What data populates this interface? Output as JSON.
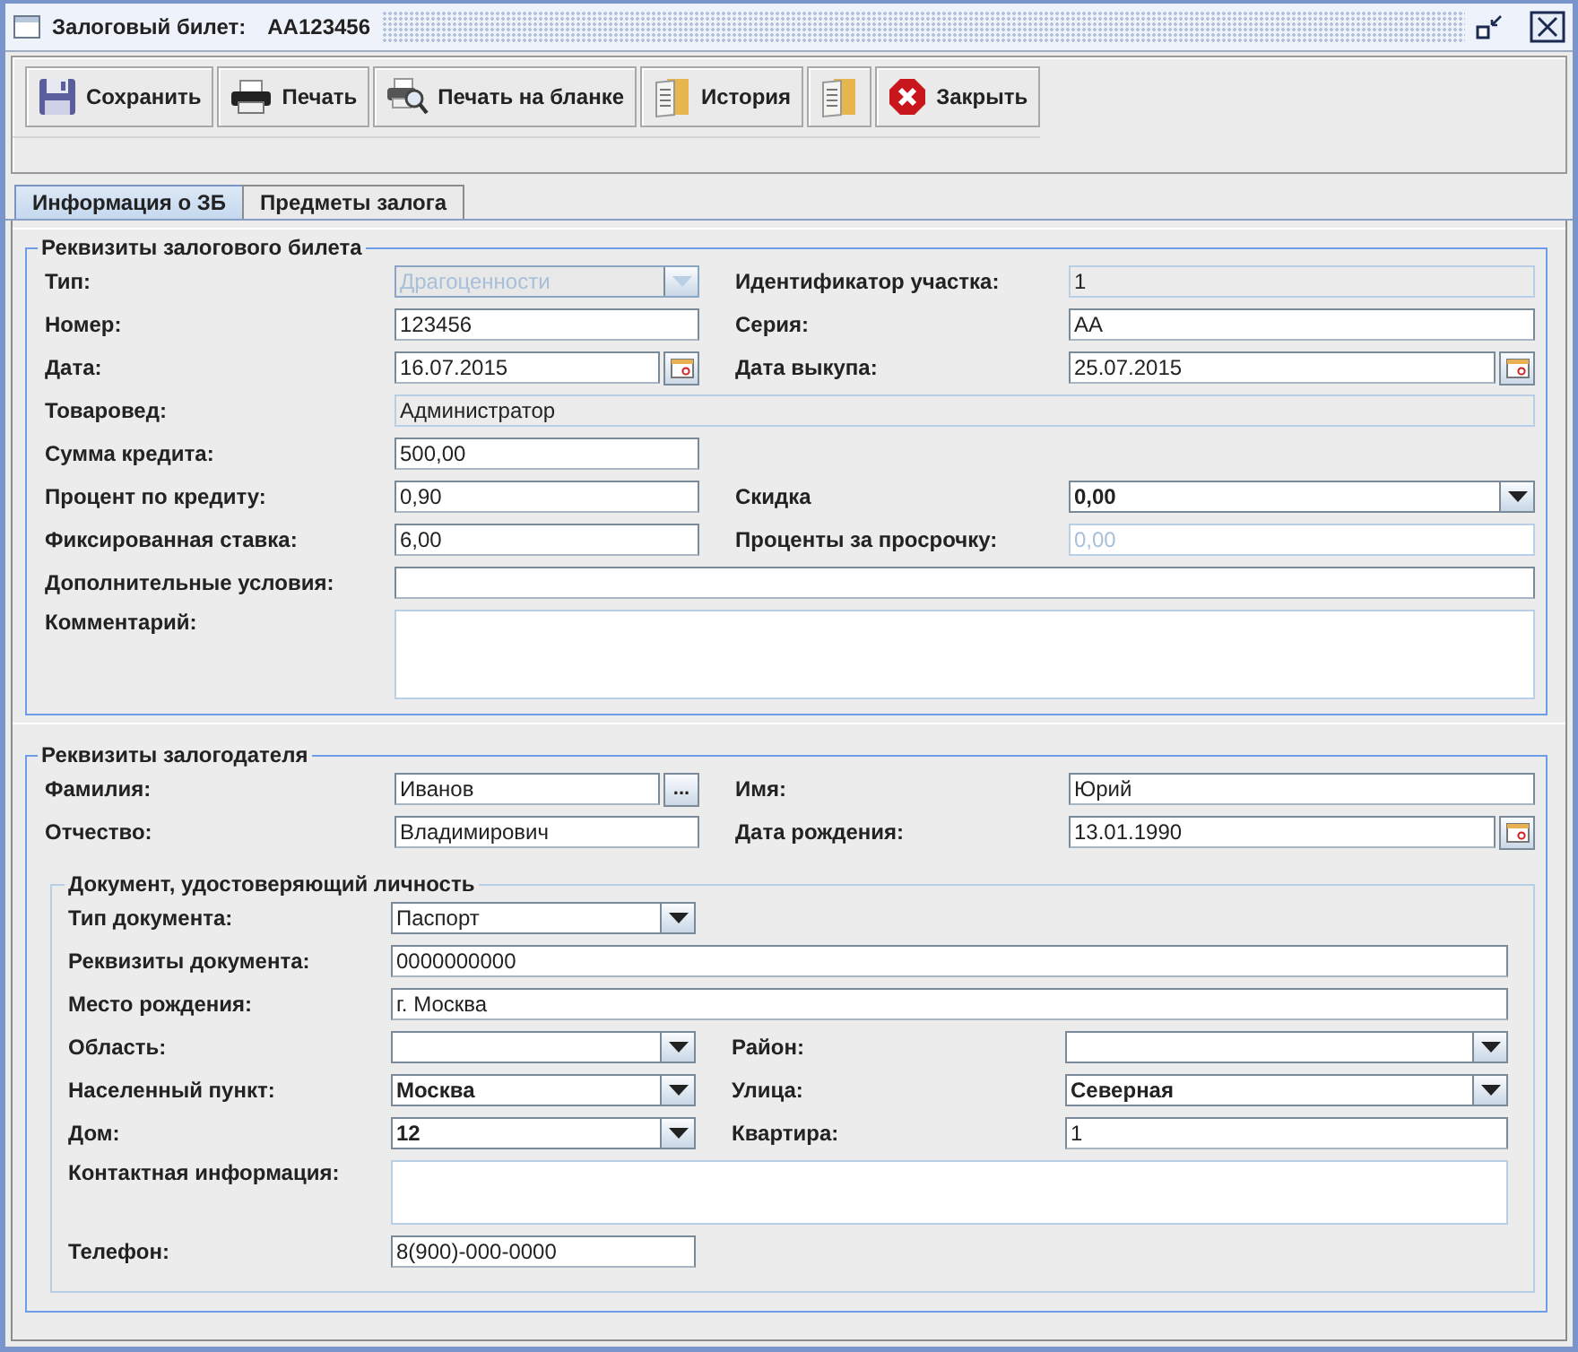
{
  "window": {
    "title": "Залоговый билет:",
    "ticket": "АА123456"
  },
  "toolbar": [
    {
      "kind": "save",
      "label": "Сохранить"
    },
    {
      "kind": "print",
      "label": "Печать"
    },
    {
      "kind": "print-preview",
      "label": "Печать на бланке"
    },
    {
      "kind": "history",
      "label": "История"
    },
    {
      "kind": "history"
    },
    {
      "kind": "close",
      "label": "Закрыть"
    }
  ],
  "tabs": [
    {
      "label": "Информация о ЗБ",
      "selected": true
    },
    {
      "label": "Предметы залога",
      "selected": false
    }
  ],
  "sections": [
    {
      "title": "Реквизиты залогового билета",
      "rows": [
        {
          "items": [
            {
              "label": "Тип:",
              "kind": "combo",
              "value": "Драгоценности",
              "disabled": true,
              "bold": false
            },
            {
              "label": "Идентификатор участка:",
              "kind": "readonly",
              "value": "1"
            }
          ]
        },
        {
          "items": [
            {
              "label": "Номер:",
              "kind": "text",
              "value": "123456",
              "disabled": false
            },
            {
              "label": "Серия:",
              "kind": "text",
              "value": "АА",
              "disabled": false
            }
          ]
        },
        {
          "items": [
            {
              "label": "Дата:",
              "kind": "date",
              "value": "16.07.2015"
            },
            {
              "label": "Дата выкупа:",
              "kind": "date",
              "value": "25.07.2015"
            }
          ]
        },
        {
          "items": [
            {
              "label": "Товаровед:",
              "kind": "readonly",
              "value": "Администратор",
              "wide": true
            }
          ]
        },
        {
          "items": [
            {
              "label": "Сумма кредита:",
              "kind": "text",
              "value": "500,00",
              "disabled": false
            }
          ]
        },
        {
          "items": [
            {
              "label": "Процент по кредиту:",
              "kind": "text",
              "value": "0,90",
              "disabled": false
            },
            {
              "label": "Скидка",
              "kind": "combo",
              "value": "0,00",
              "disabled": false,
              "bold": true
            }
          ]
        },
        {
          "items": [
            {
              "label": "Фиксированная ставка:",
              "kind": "text",
              "value": "6,00",
              "disabled": false
            },
            {
              "label": "Проценты за просрочку:",
              "kind": "text",
              "value": "0,00",
              "disabled": true
            }
          ]
        },
        {
          "items": [
            {
              "label": "Дополнительные условия:",
              "kind": "text",
              "disabled": false,
              "wide": true
            }
          ]
        },
        {
          "items": [
            {
              "label": "Комментарий:",
              "kind": "area",
              "wide": true
            }
          ]
        }
      ]
    },
    {
      "title": "Реквизиты залогодателя",
      "rows": [
        {
          "items": [
            {
              "label": "Фамилия:",
              "kind": "lookup",
              "value": "Иванов",
              "button": "..."
            },
            {
              "label": "Имя:",
              "kind": "text",
              "value": "Юрий",
              "disabled": false
            }
          ]
        },
        {
          "items": [
            {
              "label": "Отчество:",
              "kind": "text",
              "value": "Владимирович",
              "disabled": false
            },
            {
              "label": "Дата рождения:",
              "kind": "date",
              "value": "13.01.1990"
            }
          ]
        }
      ],
      "group": {
        "title": "Документ, удостоверяющий личность",
        "rows": [
          {
            "items": [
              {
                "label": "Тип документа:",
                "kind": "combo",
                "value": "Паспорт",
                "disabled": false,
                "bold": false
              }
            ]
          },
          {
            "items": [
              {
                "label": "Реквизиты документа:",
                "kind": "text",
                "value": "0000000000",
                "disabled": false,
                "wide": true
              }
            ]
          },
          {
            "items": [
              {
                "label": "Место рождения:",
                "kind": "text",
                "value": "г. Москва",
                "disabled": false,
                "wide": true
              }
            ]
          },
          {
            "items": [
              {
                "label": "Область:",
                "kind": "combo",
                "disabled": false
              },
              {
                "label": "Район:",
                "kind": "combo",
                "disabled": false
              }
            ]
          },
          {
            "items": [
              {
                "label": "Населенный пункт:",
                "kind": "combo",
                "value": "Москва",
                "disabled": false,
                "bold": true
              },
              {
                "label": "Улица:",
                "kind": "combo",
                "value": "Северная",
                "disabled": false,
                "bold": true
              }
            ]
          },
          {
            "items": [
              {
                "label": "Дом:",
                "kind": "combo",
                "value": "12",
                "disabled": false,
                "bold": true
              },
              {
                "label": "Квартира:",
                "kind": "text",
                "value": "1",
                "disabled": false
              }
            ]
          },
          {
            "items": [
              {
                "label": "Контактная информация:",
                "kind": "area",
                "wide": true
              }
            ]
          },
          {
            "items": [
              {
                "label": "Телефон:",
                "kind": "text",
                "value": "8(900)-000-0000",
                "disabled": false
              }
            ]
          }
        ]
      }
    }
  ]
}
